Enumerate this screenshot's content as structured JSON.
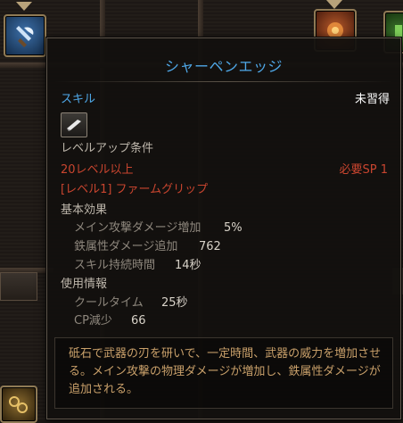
{
  "tooltip": {
    "title": "シャーペンエッジ",
    "category": "スキル",
    "status": "未習得",
    "requirements_header": "レベルアップ条件",
    "level_requirement": "20レベル以上",
    "sp_requirement": "必要SP 1",
    "prerequisite_skill": "[レベル1] ファームグリップ",
    "basic_effects_header": "基本効果",
    "effects": [
      {
        "label": "メイン攻撃ダメージ増加",
        "value": "5%"
      },
      {
        "label": "鉄属性ダメージ追加",
        "value": "762"
      },
      {
        "label": "スキル持続時間",
        "value": "14秒"
      }
    ],
    "usage_header": "使用情報",
    "usage": [
      {
        "label": "クールタイム",
        "value": "25秒"
      },
      {
        "label": "CP減少",
        "value": "66"
      }
    ],
    "description": "砥石で武器の刃を研いで、一定時間、武器の威力を増加させる。メイン攻撃の物理ダメージが増加し、鉄属性ダメージが追加される。"
  },
  "icons": {
    "skill_type": "sword-skill-icon",
    "background_slots": [
      "axe-skill-icon",
      "fire-skill-icon",
      "green-skill-icon",
      "chain-skill-icon"
    ]
  },
  "colors": {
    "title": "#4fa8e8",
    "category": "#4fa8e8",
    "requirement_red": "#c9452f",
    "description": "#c9a06a"
  }
}
